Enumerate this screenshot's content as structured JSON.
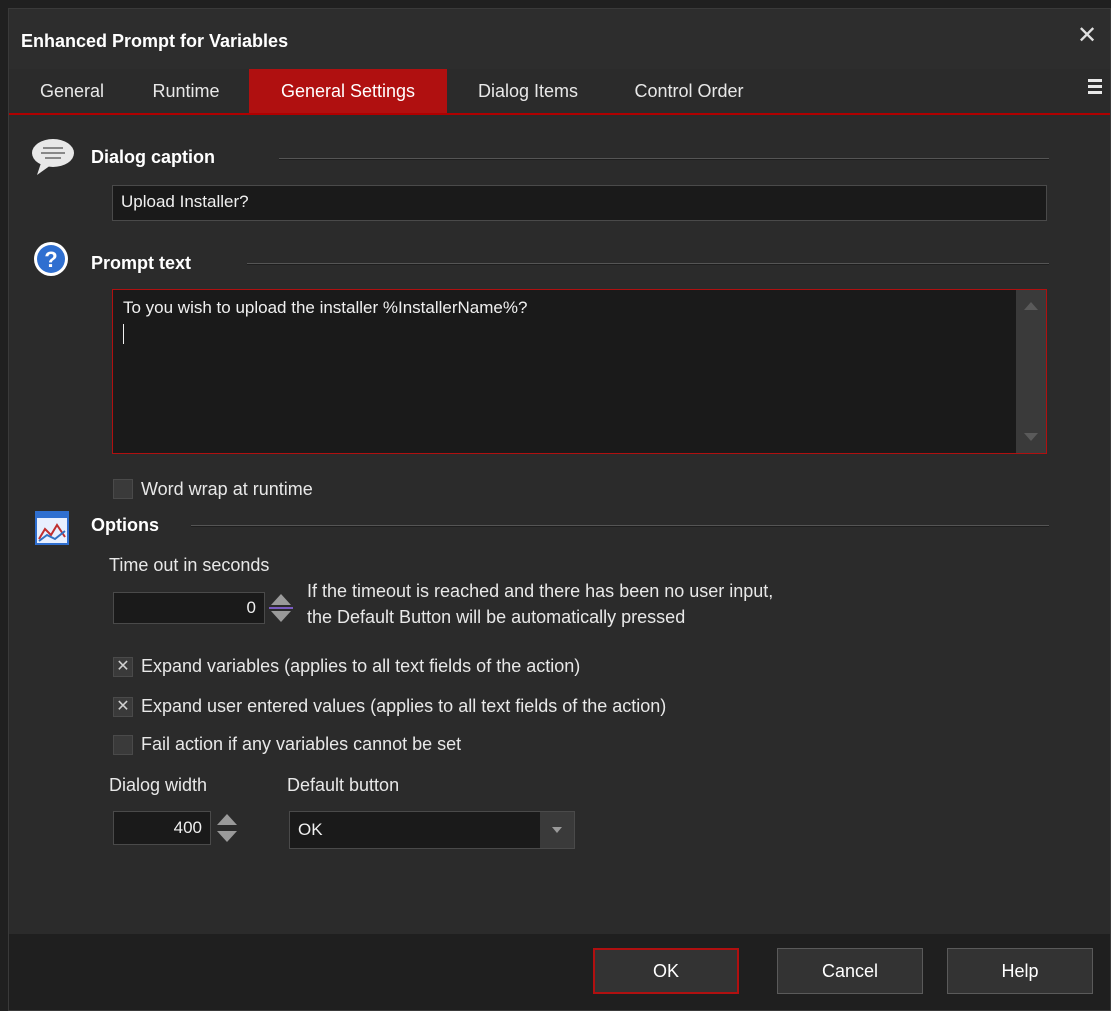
{
  "window": {
    "title": "Enhanced Prompt for Variables"
  },
  "tabs": [
    {
      "label": "General"
    },
    {
      "label": "Runtime"
    },
    {
      "label": "General Settings",
      "active": true
    },
    {
      "label": "Dialog Items"
    },
    {
      "label": "Control Order"
    }
  ],
  "sections": {
    "dialog_caption": {
      "label": "Dialog caption",
      "value": "Upload Installer?"
    },
    "prompt_text": {
      "label": "Prompt text",
      "value": "To you wish to upload the installer %InstallerName%?"
    },
    "options": {
      "label": "Options"
    }
  },
  "word_wrap": {
    "label": "Word wrap at runtime",
    "checked": false
  },
  "timeout": {
    "label": "Time out in seconds",
    "value": "0",
    "hint_line1": "If the timeout is reached and there has been no user input,",
    "hint_line2": "the Default Button will be automatically pressed"
  },
  "checkboxes": [
    {
      "label": "Expand variables (applies to all text fields of the action)",
      "checked": true
    },
    {
      "label": "Expand user entered values (applies to all text fields of the action)",
      "checked": true
    },
    {
      "label": "Fail action if any variables cannot be set",
      "checked": false
    }
  ],
  "dialog_width": {
    "label": "Dialog width",
    "value": "400"
  },
  "default_button": {
    "label": "Default button",
    "value": "OK"
  },
  "footer": {
    "ok": "OK",
    "cancel": "Cancel",
    "help": "Help"
  },
  "colors": {
    "accent": "#b01010",
    "background": "#2b2b2b",
    "input_bg": "#1a1a1a"
  }
}
